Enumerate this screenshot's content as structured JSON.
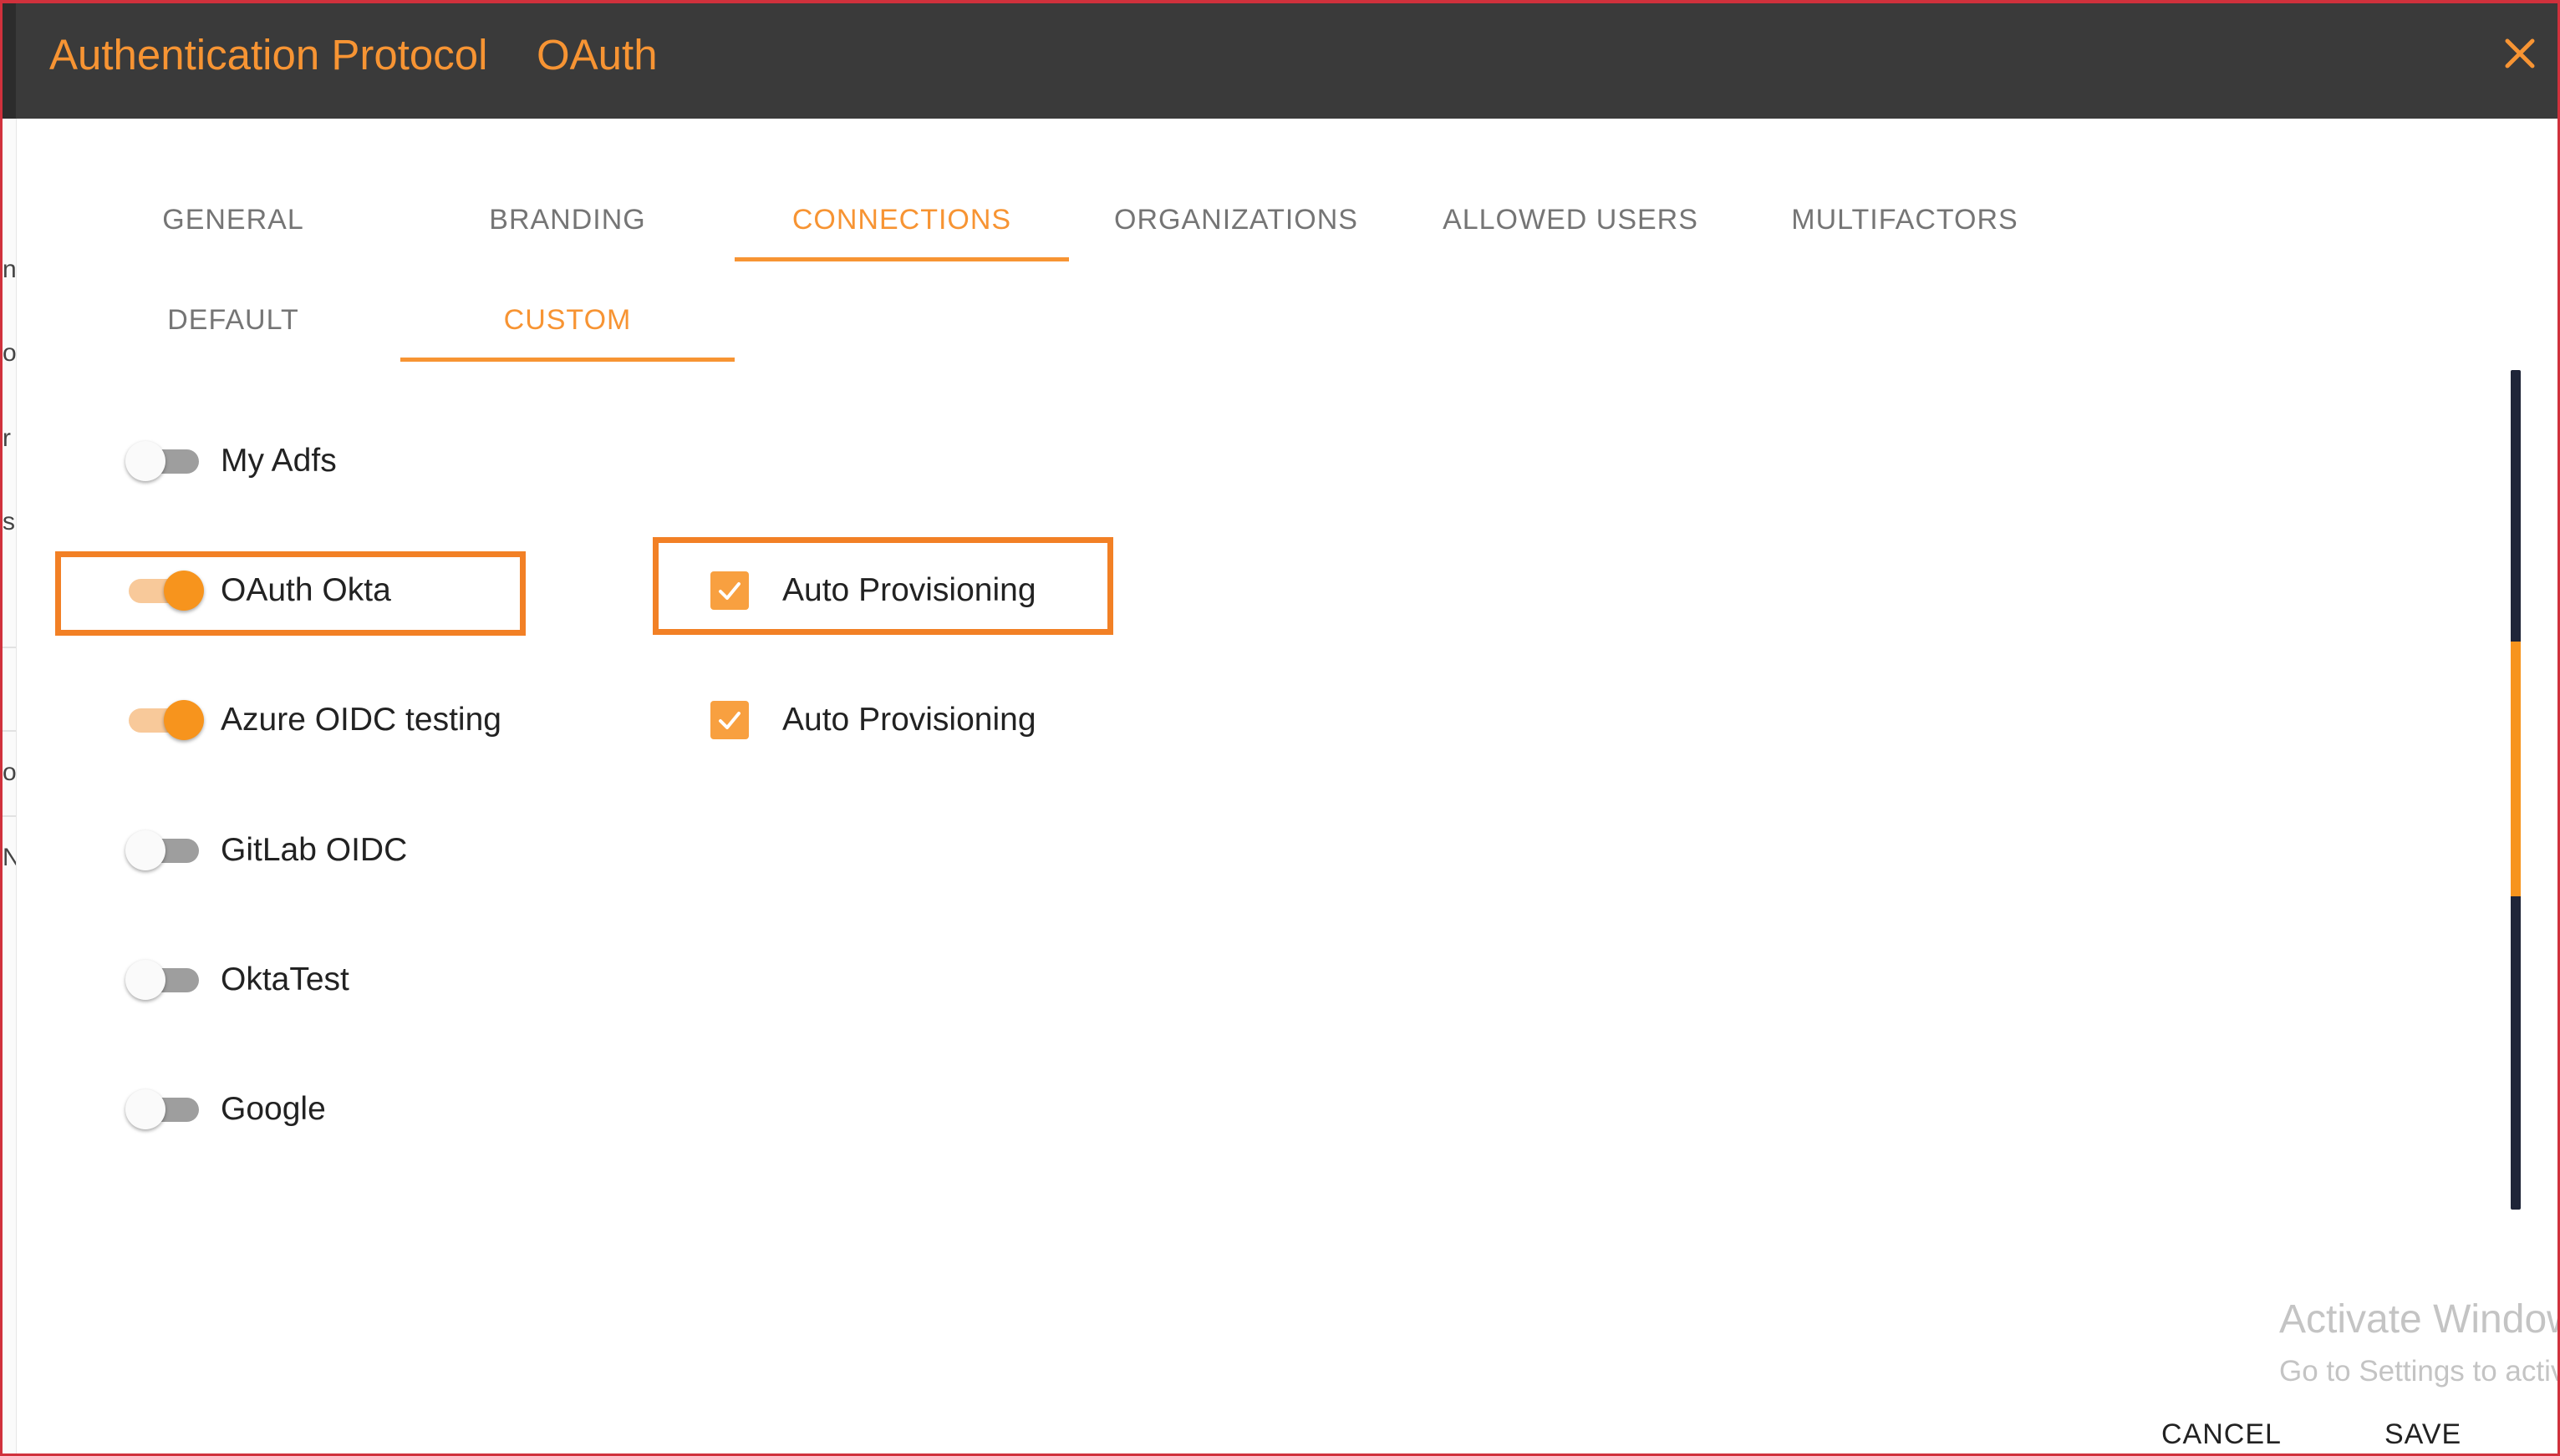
{
  "dialog": {
    "title": "Authentication Protocol",
    "subtitle": "OAuth",
    "close_glyph": "×"
  },
  "tabs": {
    "main": [
      {
        "label": "GENERAL",
        "active": false
      },
      {
        "label": "BRANDING",
        "active": false
      },
      {
        "label": "CONNECTIONS",
        "active": true
      },
      {
        "label": "ORGANIZATIONS",
        "active": false
      },
      {
        "label": "ALLOWED USERS",
        "active": false
      },
      {
        "label": "MULTIFACTORS",
        "active": false
      }
    ],
    "sub": [
      {
        "label": "DEFAULT",
        "active": false
      },
      {
        "label": "CUSTOM",
        "active": true
      }
    ]
  },
  "connections": [
    {
      "name": "My Adfs",
      "enabled": false
    },
    {
      "name": "OAuth Okta",
      "enabled": true,
      "auto_provisioning": {
        "label": "Auto Provisioning",
        "checked": true
      }
    },
    {
      "name": "Azure OIDC testing",
      "enabled": true,
      "auto_provisioning": {
        "label": "Auto Provisioning",
        "checked": true
      }
    },
    {
      "name": "GitLab OIDC",
      "enabled": false
    },
    {
      "name": "OktaTest",
      "enabled": false
    },
    {
      "name": "Google",
      "enabled": false
    }
  ],
  "background_fragments": [
    "n",
    "o",
    "r",
    "s",
    "o",
    "N"
  ],
  "watermark": {
    "line1": "Activate Windows",
    "line2": "Go to Settings to activate Windows."
  },
  "footer": {
    "cancel_label": "CANCEL",
    "save_label": "SAVE"
  },
  "colors": {
    "accent": "#f7941d",
    "header_bg": "#3a3a3a",
    "highlight": "#f28025",
    "frame": "#d0313c"
  }
}
